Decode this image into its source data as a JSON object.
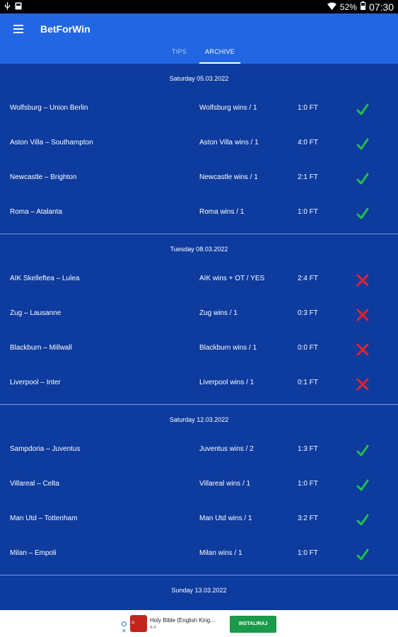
{
  "status_bar": {
    "battery": "52%",
    "time": "07:30"
  },
  "app": {
    "title": "BetForWin"
  },
  "tabs": [
    {
      "label": "TIPS",
      "selected": false
    },
    {
      "label": "ARCHIVE",
      "selected": true
    }
  ],
  "groups": [
    {
      "date": "Saturday 05.03.2022",
      "matches": [
        {
          "match": "Wolfsburg – Union Berlin",
          "tip": "Wolfsburg wins / 1",
          "score": "1:0 FT",
          "result": "win"
        },
        {
          "match": "Aston Villa – Southampton",
          "tip": "Aston Villa wins / 1",
          "score": "4:0 FT",
          "result": "win"
        },
        {
          "match": "Newcastle – Brighton",
          "tip": "Newcastle wins / 1",
          "score": "2:1 FT",
          "result": "win"
        },
        {
          "match": "Roma – Atalanta",
          "tip": "Roma wins / 1",
          "score": "1:0 FT",
          "result": "win"
        }
      ]
    },
    {
      "date": "Tuesday 08.03.2022",
      "matches": [
        {
          "match": "AIK Skelleftea – Lulea",
          "tip": "AIK wins + OT / YES",
          "score": "2:4 FT",
          "result": "loss"
        },
        {
          "match": "Zug – Lausanne",
          "tip": "Zug wins / 1",
          "score": "0:3 FT",
          "result": "loss"
        },
        {
          "match": "Blackburn – Millwall",
          "tip": "Blackburn wins / 1",
          "score": "0:0 FT",
          "result": "loss"
        },
        {
          "match": "Liverpool – Inter",
          "tip": "Liverpool wins / 1",
          "score": "0:1 FT",
          "result": "loss"
        }
      ]
    },
    {
      "date": "Saturday 12.03.2022",
      "matches": [
        {
          "match": "Sampdoria – Juventus",
          "tip": "Juventus wins / 2",
          "score": "1:3 FT",
          "result": "win"
        },
        {
          "match": "Villareal – Celta",
          "tip": "Villareal wins / 1",
          "score": "1:0 FT",
          "result": "win"
        },
        {
          "match": "Man Utd – Tottenham",
          "tip": "Man Utd wins / 1",
          "score": "3:2 FT",
          "result": "win"
        },
        {
          "match": "Milan – Empoli",
          "tip": "Milan wins / 1",
          "score": "1:0 FT",
          "result": "win"
        }
      ]
    },
    {
      "date": "Sunday 13.03.2022",
      "matches": []
    }
  ],
  "ad": {
    "app_name": "Holy Bible (English King...",
    "rating": "4.4",
    "button": "INSTALIRAJ",
    "close": "✕"
  },
  "colors": {
    "win": "#21c04a",
    "loss": "#e5222b",
    "background": "#0d3b9e",
    "appbar": "#2266e3"
  }
}
